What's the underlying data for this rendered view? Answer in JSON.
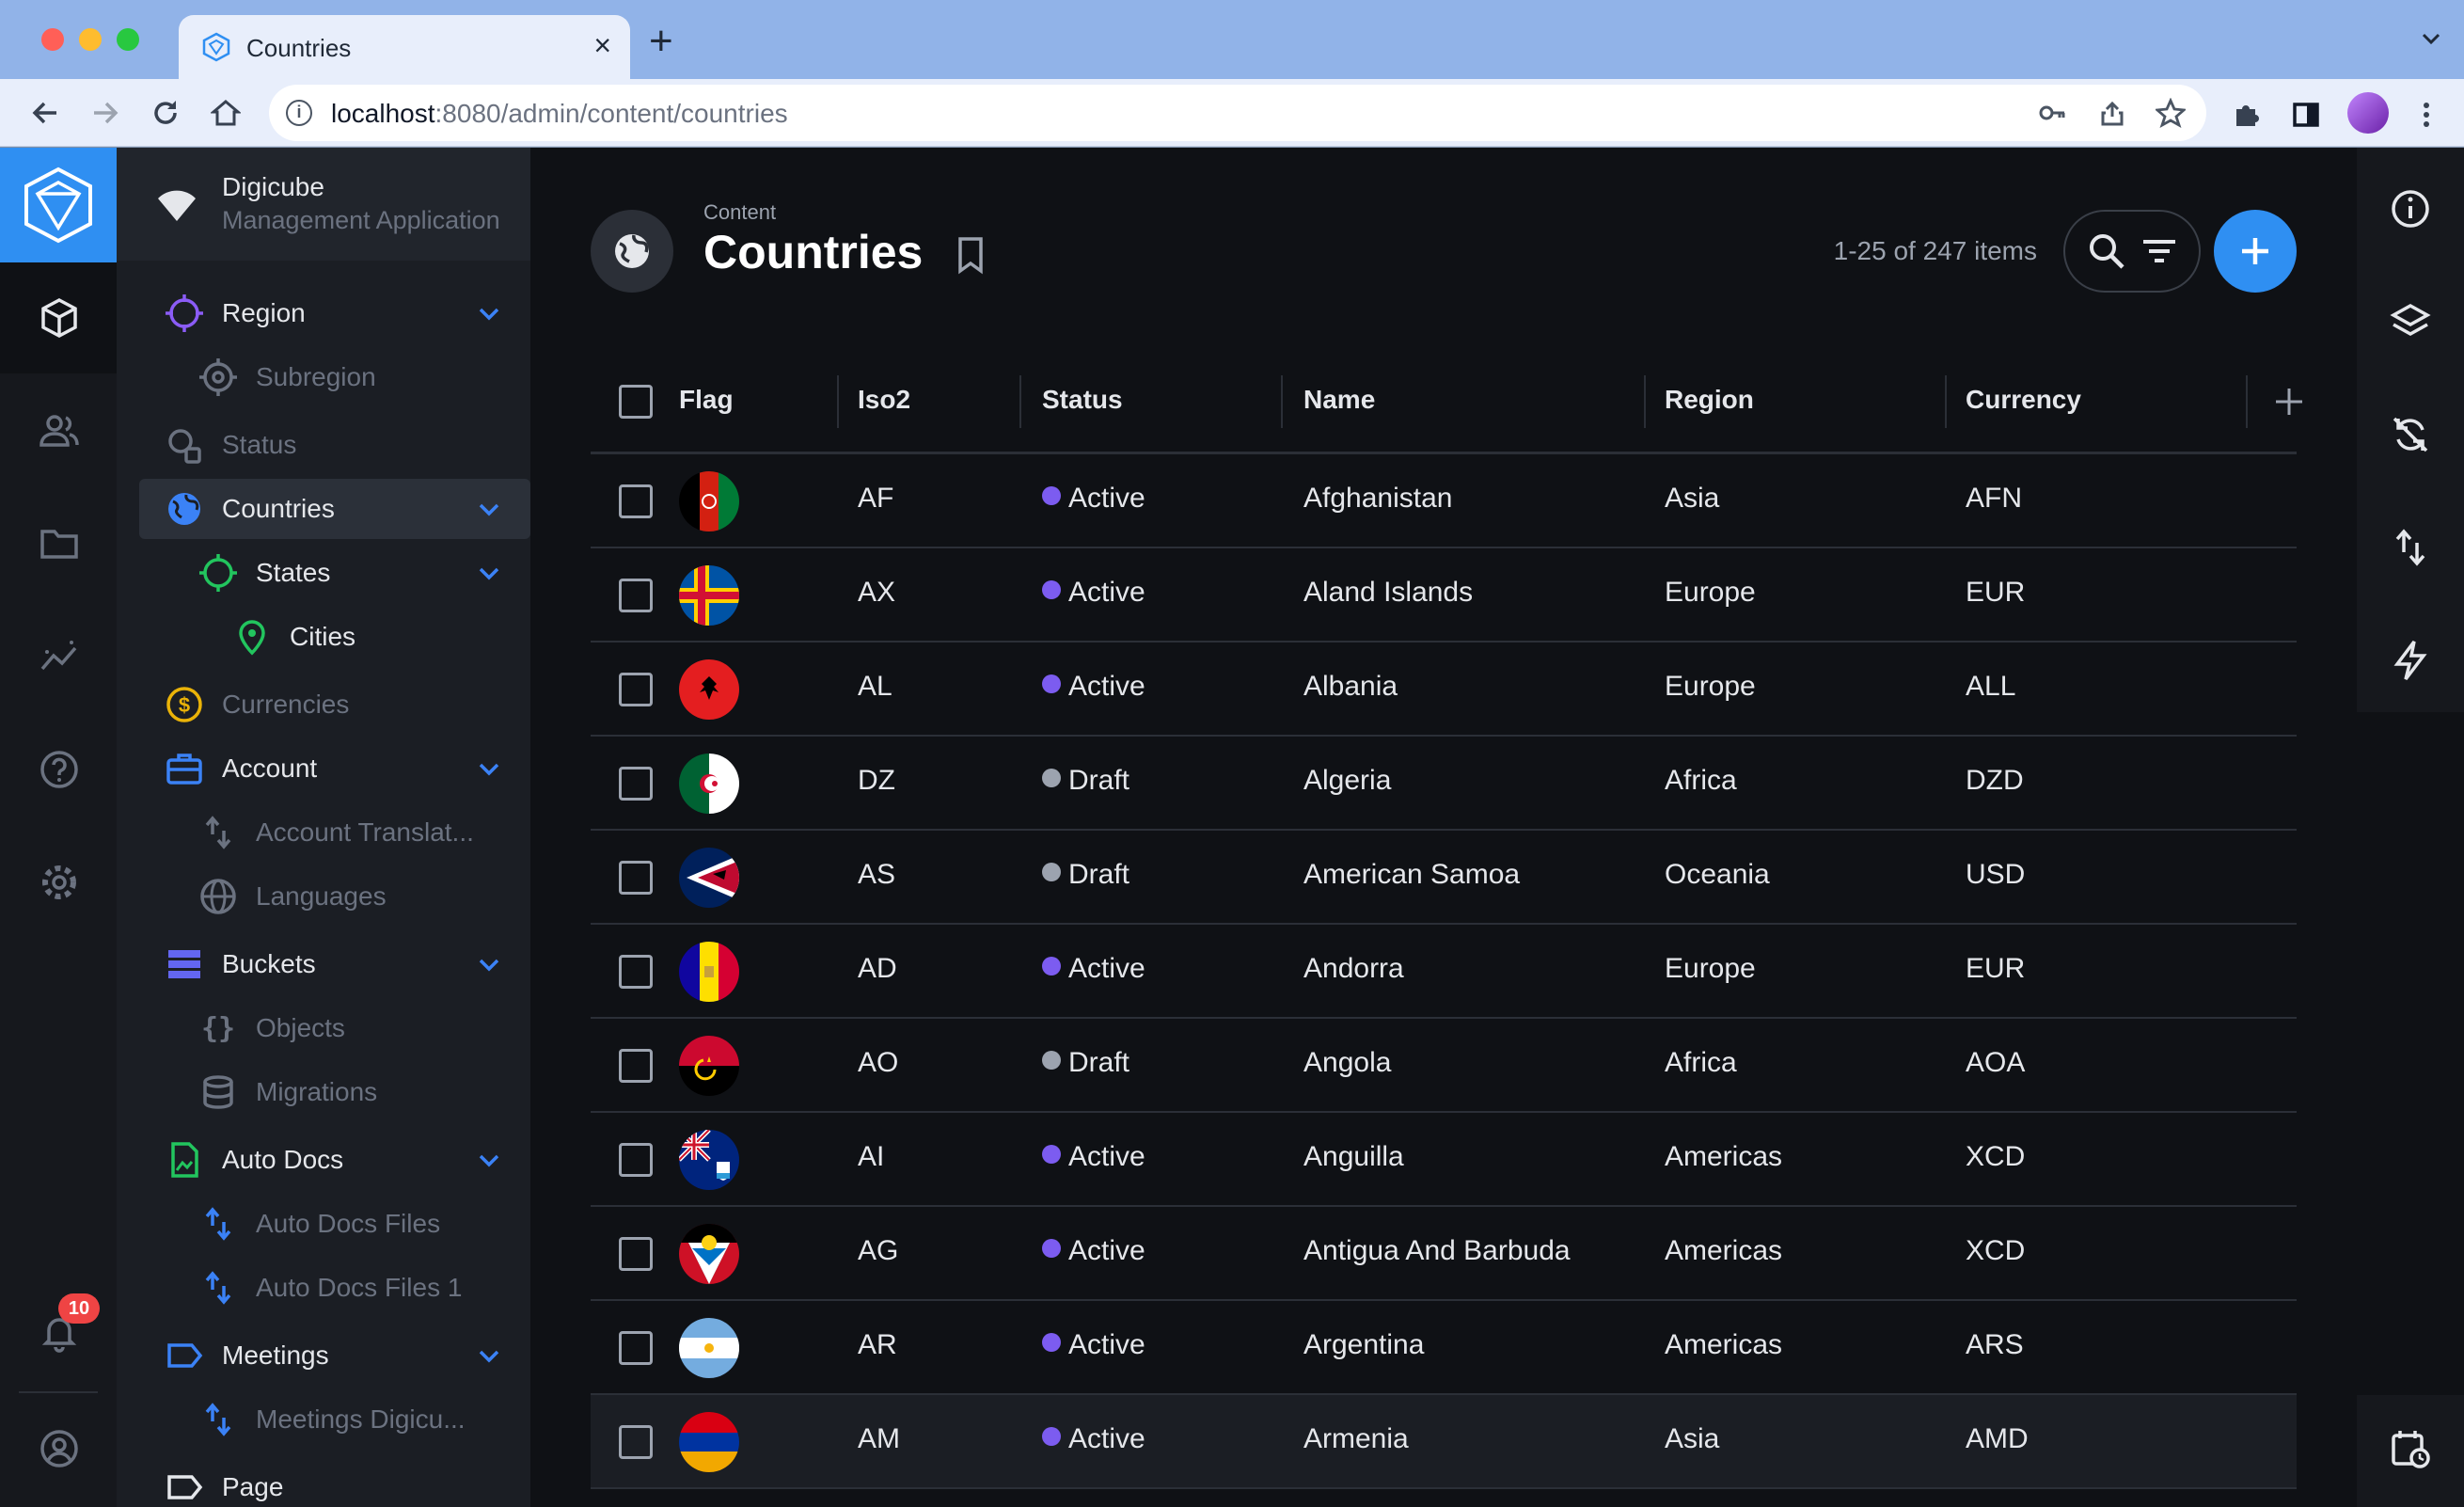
{
  "browser": {
    "tab_title": "Countries",
    "url_host": "localhost",
    "url_rest": ":8080/admin/content/countries"
  },
  "project": {
    "name": "Digicube",
    "subtitle": "Management Application"
  },
  "rail": {
    "notification_count": "10"
  },
  "nav": {
    "items": [
      {
        "label": "Region",
        "icon": "target-icon",
        "level": 0,
        "expandable": true,
        "muted": false
      },
      {
        "label": "Subregion",
        "icon": "crosshair-icon",
        "level": 1,
        "expandable": false,
        "muted": true
      },
      {
        "label": "Status",
        "icon": "status-icon",
        "level": 0,
        "expandable": false,
        "muted": true
      },
      {
        "label": "Countries",
        "icon": "globe-icon",
        "level": 0,
        "expandable": true,
        "muted": false,
        "active": true
      },
      {
        "label": "States",
        "icon": "circle-icon",
        "level": 1,
        "expandable": true,
        "muted": false
      },
      {
        "label": "Cities",
        "icon": "map-pin-icon",
        "level": 2,
        "expandable": false,
        "muted": false
      },
      {
        "label": "Currencies",
        "icon": "dollar-icon",
        "level": 0,
        "expandable": false,
        "muted": true
      },
      {
        "label": "Account",
        "icon": "briefcase-icon",
        "level": 0,
        "expandable": true,
        "muted": false
      },
      {
        "label": "Account Translat...",
        "icon": "translate-icon",
        "level": 1,
        "expandable": false,
        "muted": true
      },
      {
        "label": "Languages",
        "icon": "language-icon",
        "level": 1,
        "expandable": false,
        "muted": true
      },
      {
        "label": "Buckets",
        "icon": "list-icon",
        "level": 0,
        "expandable": true,
        "muted": false
      },
      {
        "label": "Objects",
        "icon": "braces-icon",
        "level": 1,
        "expandable": false,
        "muted": true
      },
      {
        "label": "Migrations",
        "icon": "database-icon",
        "level": 1,
        "expandable": false,
        "muted": true
      },
      {
        "label": "Auto Docs",
        "icon": "document-icon",
        "level": 0,
        "expandable": true,
        "muted": false
      },
      {
        "label": "Auto Docs Files",
        "icon": "translate-icon",
        "level": 1,
        "expandable": false,
        "muted": true
      },
      {
        "label": "Auto Docs Files 1",
        "icon": "translate-icon",
        "level": 1,
        "expandable": false,
        "muted": true
      },
      {
        "label": "Meetings",
        "icon": "label-icon",
        "level": 0,
        "expandable": true,
        "muted": false
      },
      {
        "label": "Meetings Digicu...",
        "icon": "translate-icon",
        "level": 1,
        "expandable": false,
        "muted": true
      },
      {
        "label": "Page",
        "icon": "label-icon",
        "level": 0,
        "expandable": false,
        "muted": false
      }
    ]
  },
  "header": {
    "breadcrumb": "Content",
    "title": "Countries",
    "item_count": "1-25 of 247 items"
  },
  "table": {
    "columns": [
      "Flag",
      "Iso2",
      "Status",
      "Name",
      "Region",
      "Currency"
    ],
    "rows": [
      {
        "iso2": "AF",
        "status": "Active",
        "name": "Afghanistan",
        "region": "Asia",
        "currency": "AFN"
      },
      {
        "iso2": "AX",
        "status": "Active",
        "name": "Aland Islands",
        "region": "Europe",
        "currency": "EUR"
      },
      {
        "iso2": "AL",
        "status": "Active",
        "name": "Albania",
        "region": "Europe",
        "currency": "ALL"
      },
      {
        "iso2": "DZ",
        "status": "Draft",
        "name": "Algeria",
        "region": "Africa",
        "currency": "DZD"
      },
      {
        "iso2": "AS",
        "status": "Draft",
        "name": "American Samoa",
        "region": "Oceania",
        "currency": "USD"
      },
      {
        "iso2": "AD",
        "status": "Active",
        "name": "Andorra",
        "region": "Europe",
        "currency": "EUR"
      },
      {
        "iso2": "AO",
        "status": "Draft",
        "name": "Angola",
        "region": "Africa",
        "currency": "AOA"
      },
      {
        "iso2": "AI",
        "status": "Active",
        "name": "Anguilla",
        "region": "Americas",
        "currency": "XCD"
      },
      {
        "iso2": "AG",
        "status": "Active",
        "name": "Antigua And Barbuda",
        "region": "Americas",
        "currency": "XCD"
      },
      {
        "iso2": "AR",
        "status": "Active",
        "name": "Argentina",
        "region": "Americas",
        "currency": "ARS"
      },
      {
        "iso2": "AM",
        "status": "Active",
        "name": "Armenia",
        "region": "Asia",
        "currency": "AMD"
      }
    ]
  },
  "colors": {
    "accent": "#2f8ff2",
    "status_active": "#7c5cf0",
    "status_draft": "#9ca3af",
    "nav_icon_purple": "#8b5cf6",
    "nav_icon_green": "#22c55e",
    "nav_icon_blue": "#3b82f6",
    "nav_icon_yellow": "#eab308"
  }
}
